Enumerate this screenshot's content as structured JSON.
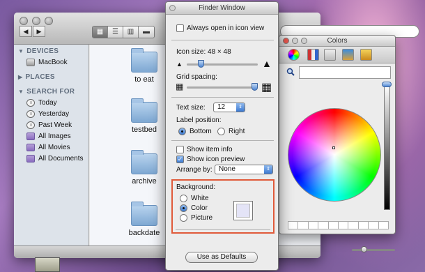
{
  "finder": {
    "sidebar": {
      "devices_header": "DEVICES",
      "devices": [
        "MacBook"
      ],
      "places_header": "PLACES",
      "search_header": "SEARCH FOR",
      "searches": [
        "Today",
        "Yesterday",
        "Past Week",
        "All Images",
        "All Movies",
        "All Documents"
      ]
    },
    "files": [
      "to eat",
      "testbed",
      "archive",
      "backdate"
    ]
  },
  "options_panel": {
    "title": "Finder Window",
    "always_open_icon_view": "Always open in icon view",
    "icon_size_label": "Icon size:",
    "icon_size_value": "48 × 48",
    "grid_spacing_label": "Grid spacing:",
    "text_size_label": "Text size:",
    "text_size_value": "12",
    "label_position_label": "Label position:",
    "label_bottom": "Bottom",
    "label_right": "Right",
    "show_item_info": "Show item info",
    "show_icon_preview": "Show icon preview",
    "arrange_by_label": "Arrange by:",
    "arrange_by_value": "None",
    "background_label": "Background:",
    "bg_white": "White",
    "bg_color": "Color",
    "bg_picture": "Picture",
    "use_as_defaults": "Use as Defaults",
    "icon_size_level": 0.2,
    "grid_spacing_level": 0.95,
    "accent_color": "#e05a3a"
  },
  "colors_panel": {
    "title": "Colors",
    "brightness_level": 1.0
  }
}
